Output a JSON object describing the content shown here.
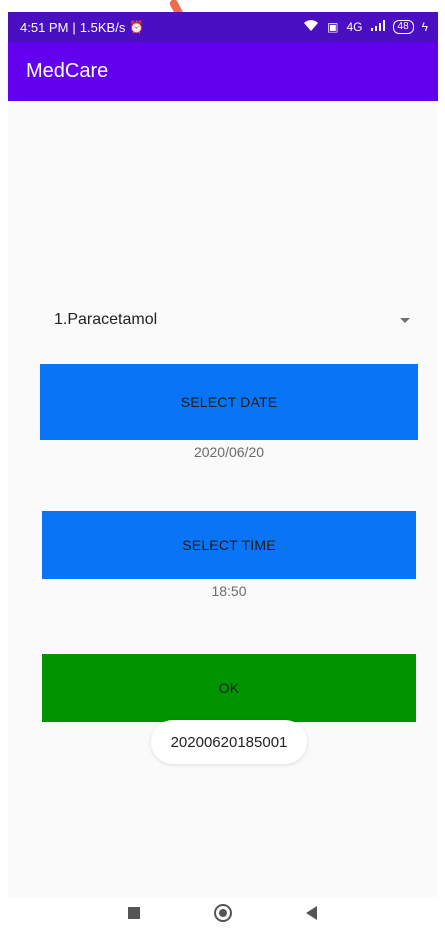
{
  "status_bar": {
    "time": "4:51 PM",
    "network_speed": "1.5KB/s",
    "alarm_icon": "alarm-clock-icon",
    "wifi_icon": "wifi-icon",
    "signal_label": "4G",
    "battery": "48",
    "charging_icon": "lightning-icon"
  },
  "app_bar": {
    "title": "MedCare"
  },
  "medicine_spinner": {
    "selected": "1.Paracetamol"
  },
  "date": {
    "button_label": "SELECT DATE",
    "value": "2020/06/20"
  },
  "time": {
    "button_label": "SELECT TIME",
    "value": "18:50"
  },
  "ok_button": {
    "label": "OK"
  },
  "toast": {
    "message": "20200620185001"
  },
  "colors": {
    "status_bar": "#4a0fc0",
    "app_bar": "#6200ee",
    "date_time_buttons": "#0a74f7",
    "ok_button": "#009400",
    "background": "#fafafa"
  },
  "navigation": {
    "recents_icon": "square-icon",
    "home_icon": "circle-icon",
    "back_icon": "triangle-back-icon"
  }
}
